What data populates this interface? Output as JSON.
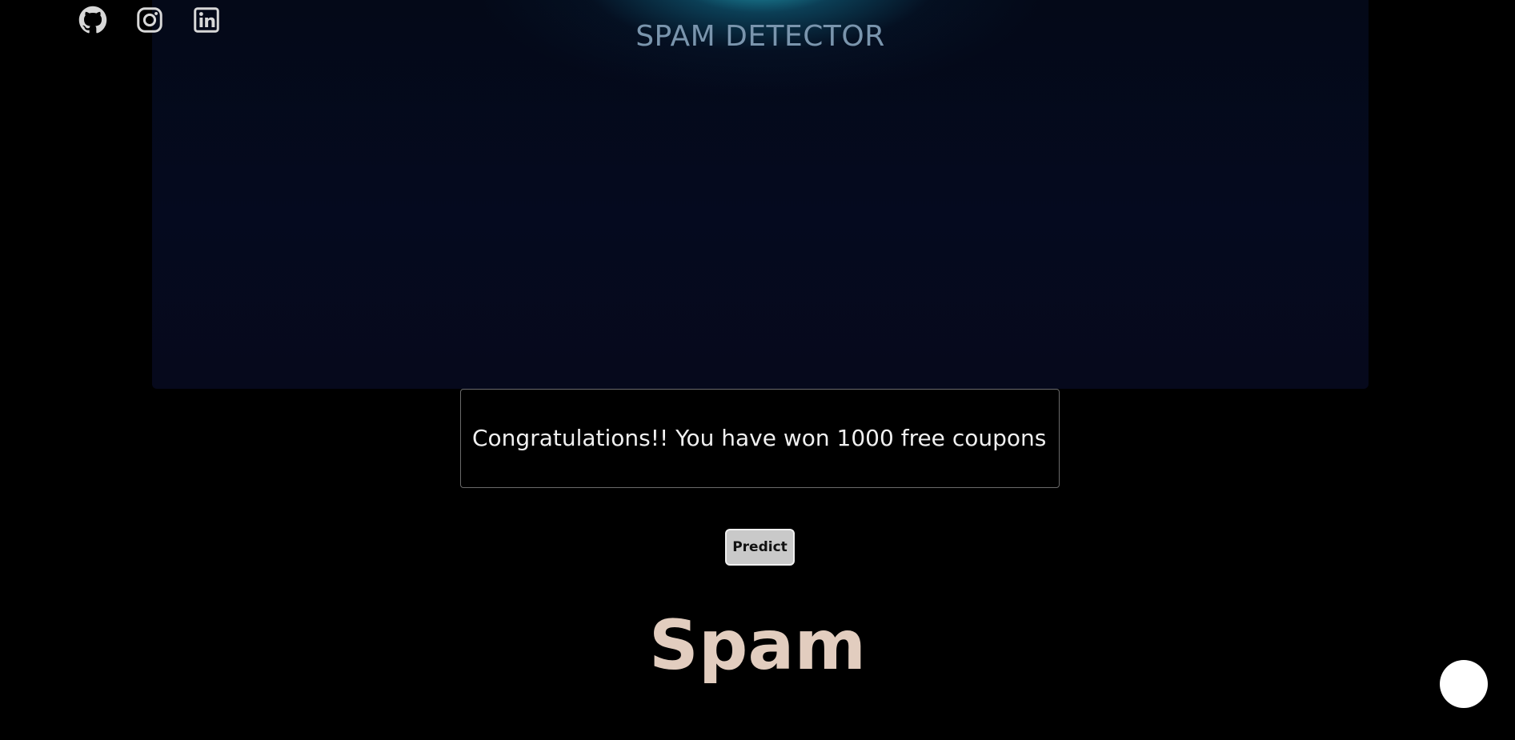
{
  "header": {
    "title": "SPAM DETECTOR"
  },
  "social": {
    "icons": [
      "github-icon",
      "instagram-icon",
      "linkedin-icon"
    ]
  },
  "form": {
    "message_value": "Congratulations!! You have won 1000 free coupons",
    "predict_label": "Predict"
  },
  "result": {
    "label": "Spam"
  },
  "colors": {
    "background": "#000000",
    "hero_glow": "#26b2c8",
    "title": "#7a95ad",
    "result": "#e2cdbf",
    "button_bg": "#c9c9c9"
  }
}
